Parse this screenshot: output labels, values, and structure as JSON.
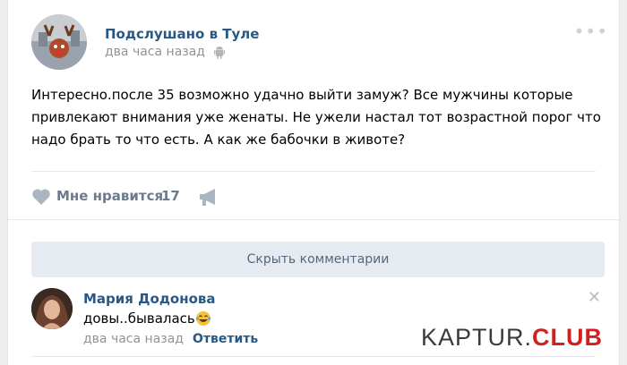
{
  "post": {
    "author": "Подслушано в Туле",
    "time": "два часа назад",
    "text": "Интересно.после 35 возможно удачно выйти замуж? Все мужчины которые привлекают внимания уже женаты. Не ужели настал тот возрастной порог что надо брать то что есть. А как же бабочки в животе?",
    "like_label": "Мне нравится",
    "like_count": "17",
    "menu_icon": "•••"
  },
  "comments_toggle": {
    "label": "Скрыть комментарии"
  },
  "comment": {
    "author": "Мария Додонова",
    "text": "довы..бывалась",
    "emoji": "laughing-tears-icon",
    "time": "два часа назад",
    "reply_label": "Ответить",
    "close_glyph": "✕"
  },
  "watermark": {
    "part1": "KAPTUR.",
    "part2": "CLUB"
  },
  "colors": {
    "link": "#2a5885",
    "muted": "#939393",
    "button_bg": "#e5ebf1",
    "watermark_red": "#d31f1f"
  }
}
